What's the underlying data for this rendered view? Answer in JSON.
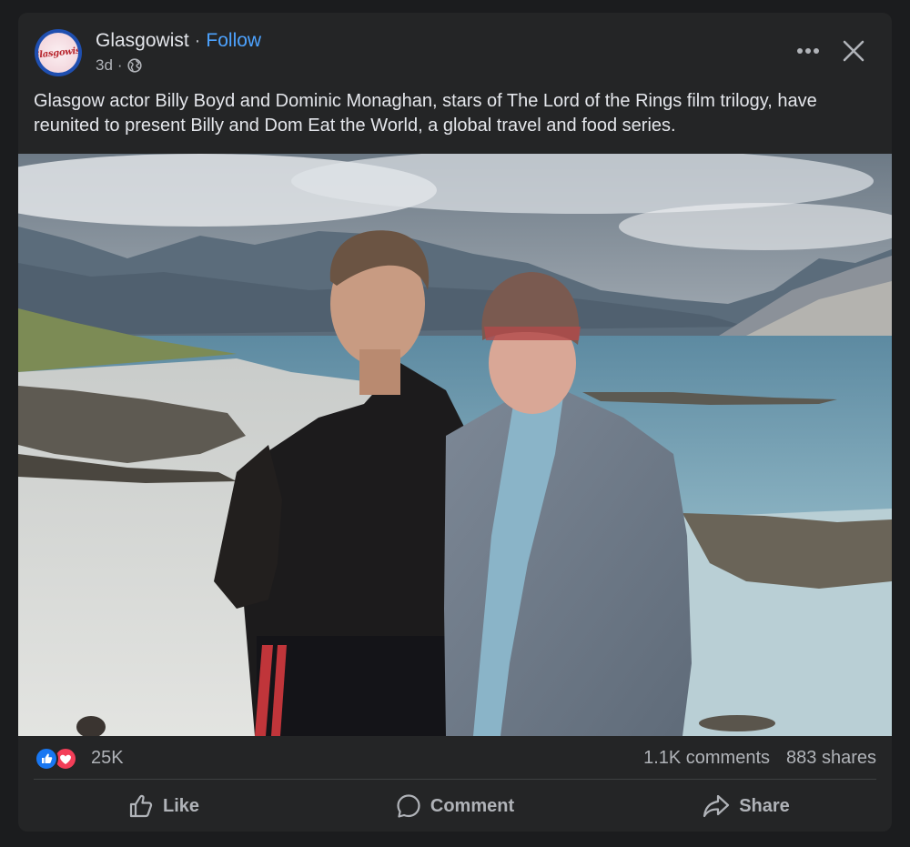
{
  "post": {
    "author": "Glasgowist",
    "separator": "·",
    "follow_label": "Follow",
    "time_ago": "3d",
    "time_separator": "·",
    "audience_icon": "globe-icon",
    "avatar_logo_text": "Glasgowist",
    "caption": "Glasgow actor Billy Boyd and Dominic Monaghan, stars of The Lord of the Rings film trilogy, have reunited to present Billy and Dom Eat the World, a global travel and food series.",
    "more_icon": "more-options-icon",
    "close_icon": "close-icon"
  },
  "engagement": {
    "reaction_icons": [
      "like-reaction-icon",
      "love-reaction-icon"
    ],
    "reaction_count": "25K",
    "comments": "1.1K comments",
    "shares": "883 shares"
  },
  "actions": {
    "like_label": "Like",
    "comment_label": "Comment",
    "share_label": "Share"
  },
  "colors": {
    "background": "#1b1c1e",
    "card": "#242526",
    "text_primary": "#e4e6eb",
    "text_secondary": "#b0b3b8",
    "follow_blue": "#4da3ff",
    "like_blue": "#1877f2",
    "love_red": "#f33e58"
  }
}
